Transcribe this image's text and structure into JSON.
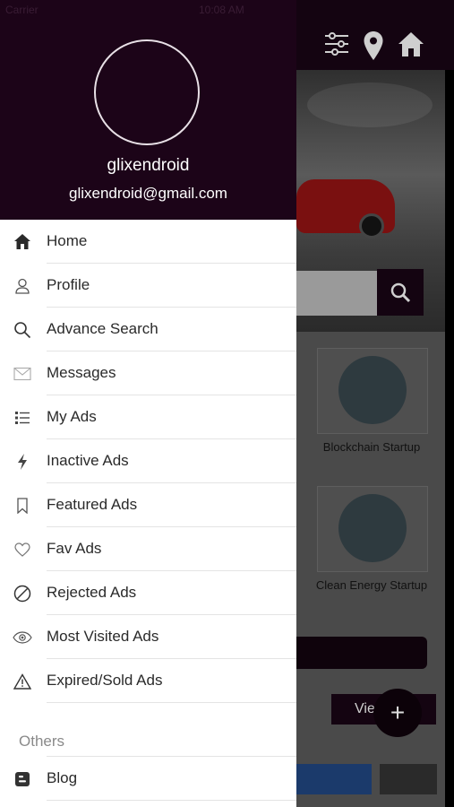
{
  "status_bar": {
    "carrier": "Carrier",
    "time": "10:08 AM"
  },
  "profile": {
    "name": "glixendroid",
    "email": "glixendroid@gmail.com"
  },
  "menu": [
    {
      "label": "Home",
      "icon": "home-icon"
    },
    {
      "label": "Profile",
      "icon": "user-icon"
    },
    {
      "label": "Advance Search",
      "icon": "search-icon"
    },
    {
      "label": "Messages",
      "icon": "envelope-icon"
    },
    {
      "label": "My Ads",
      "icon": "list-icon"
    },
    {
      "label": "Inactive Ads",
      "icon": "bolt-icon"
    },
    {
      "label": "Featured Ads",
      "icon": "bookmark-icon"
    },
    {
      "label": "Fav Ads",
      "icon": "heart-icon"
    },
    {
      "label": "Rejected Ads",
      "icon": "ban-icon"
    },
    {
      "label": "Most Visited Ads",
      "icon": "eye-icon"
    },
    {
      "label": "Expired/Sold  Ads",
      "icon": "warning-icon"
    }
  ],
  "others": {
    "title": "Others",
    "items": [
      {
        "label": "Blog",
        "icon": "blog-icon"
      }
    ]
  },
  "background": {
    "cards": [
      "Blockchain Startup",
      "Clean Energy Startup"
    ],
    "view_button": "View All",
    "fab": "+",
    "header_icons": [
      "filter-icon",
      "location-pin-icon",
      "home-icon"
    ]
  },
  "colors": {
    "brand_dark": "#1c0418",
    "menu_text": "#2a2a2a",
    "section_text": "#8a8a8a"
  }
}
